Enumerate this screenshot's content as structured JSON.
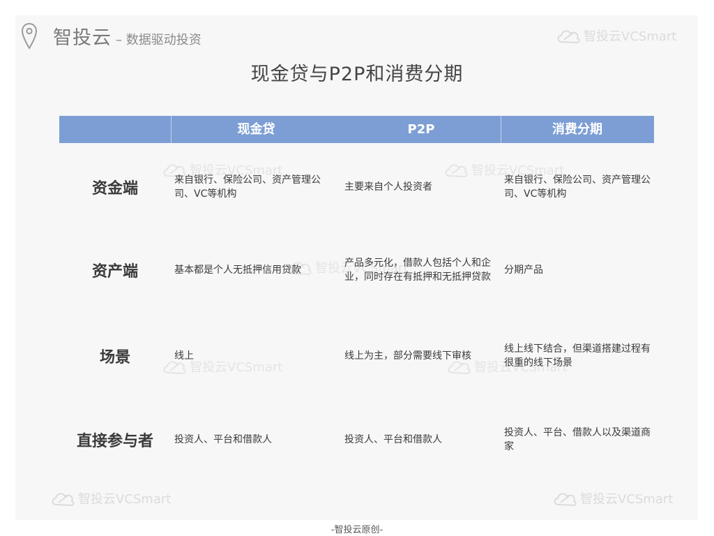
{
  "header": {
    "brand_name": "智投云",
    "brand_tagline": "– 数据驱动投资"
  },
  "watermark_text": "智投云VCSmart",
  "title": "现金贷与P2P和消费分期",
  "table": {
    "columns": [
      "",
      "现金贷",
      "P2P",
      "消费分期"
    ],
    "rows": [
      {
        "label": "资金端",
        "cells": [
          "来自银行、保险公司、资产管理公司、VC等机构",
          "主要来自个人投资者",
          "来自银行、保险公司、资产管理公司、VC等机构"
        ]
      },
      {
        "label": "资产端",
        "cells": [
          "基本都是个人无抵押信用贷款",
          "产品多元化，借款人包括个人和企业，同时存在有抵押和无抵押贷款",
          "分期产品"
        ]
      },
      {
        "label": "场景",
        "cells": [
          "线上",
          "线上为主，部分需要线下审核",
          "线上线下结合，但渠道搭建过程有很重的线下场景"
        ]
      },
      {
        "label": "直接参与者",
        "cells": [
          "投资人、平台和借款人",
          "投资人、平台和借款人",
          "投资人、平台、借款人以及渠道商家"
        ]
      }
    ]
  },
  "footer": "-智投云原创-",
  "colors": {
    "header_bg": "#7c9ed4",
    "slide_bg": "#f7f7f7",
    "watermark": "#d9d9d9"
  },
  "icons": {
    "pin": "map-pin-icon",
    "watermark_logo": "cloud-logo-icon"
  }
}
